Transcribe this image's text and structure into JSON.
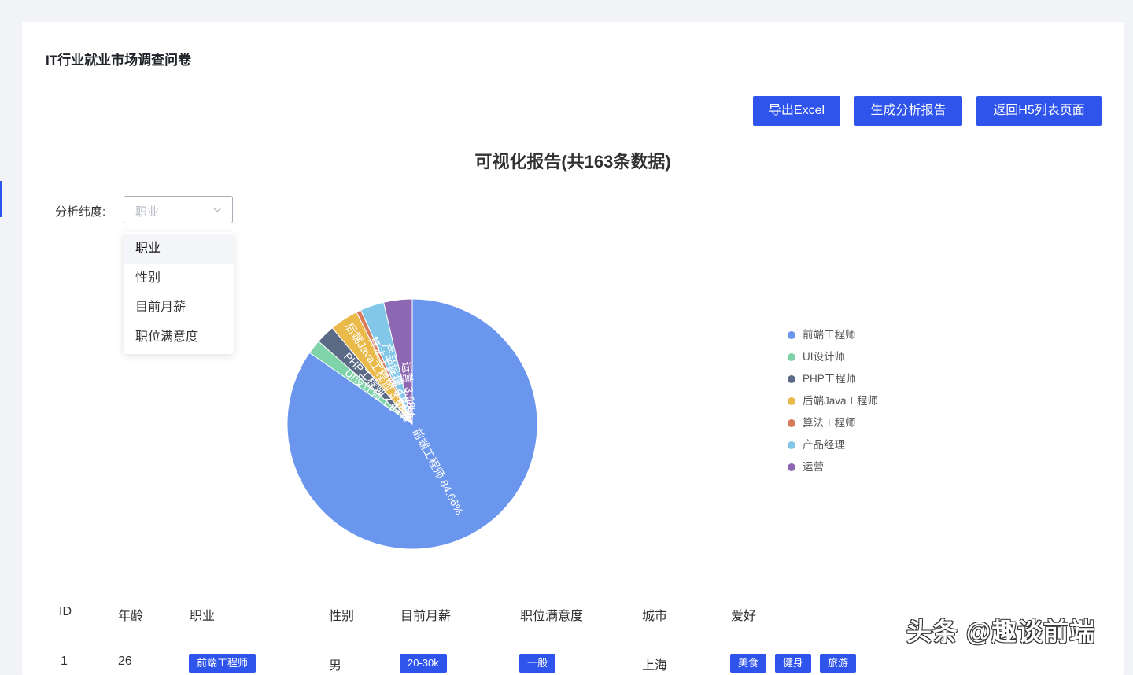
{
  "page_title": "IT行业就业市场调查问卷",
  "buttons": {
    "export_excel": "导出Excel",
    "generate_report": "生成分析报告",
    "back_h5": "返回H5列表页面"
  },
  "report_title": "可视化报告(共163条数据)",
  "filter": {
    "label": "分析纬度:",
    "selected": "职业",
    "options": [
      "职业",
      "性别",
      "目前月薪",
      "职位满意度"
    ]
  },
  "chart_data": {
    "type": "pie",
    "categories": [
      "前端工程师",
      "UI设计师",
      "PHP工程师",
      "后端Java工程师",
      "算法工程师",
      "产品经理",
      "运营"
    ],
    "values": [
      84.66,
      1.84,
      2.45,
      3.68,
      0.61,
      3.07,
      3.68
    ],
    "unit": "%",
    "slice_labels": [
      "前端工程师 84.66%",
      "UI设计师 1.84%",
      "PHP工程师 2.45%",
      "后端Java工程师 3.68%",
      "算法工程师 0.61%",
      "产品经理 3.07%",
      "运营 3.68%"
    ],
    "colors": [
      "#6b96ee",
      "#7fd3a8",
      "#5b6b86",
      "#e9b94a",
      "#d77a5b",
      "#82c7e8",
      "#8e67b3"
    ],
    "legend_position": "right"
  },
  "table": {
    "headers": [
      "ID",
      "年龄",
      "职业",
      "性别",
      "目前月薪",
      "职位满意度",
      "城市",
      "爱好"
    ],
    "row": {
      "id": "1",
      "age": "26",
      "job": "前端工程师",
      "gender": "男",
      "salary": "20-30k",
      "satisfaction": "一般",
      "city": "上海",
      "hobbies": [
        "美食",
        "健身",
        "旅游"
      ]
    }
  },
  "watermark": "头条 @趣谈前端"
}
